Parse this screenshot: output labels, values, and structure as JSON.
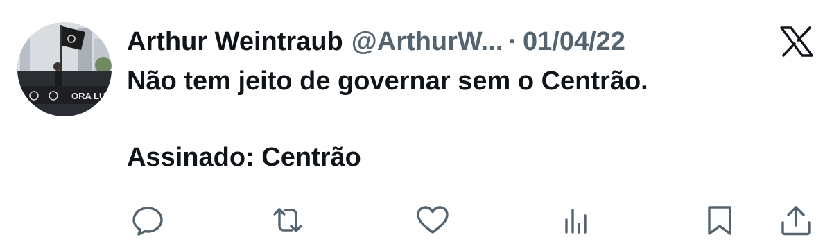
{
  "author": {
    "name": "Arthur Weintraub",
    "handle": "@ArthurW...",
    "separator": "·",
    "date": "01/04/22"
  },
  "tweet": {
    "line1": "Não tem jeito de governar sem o Centrão.",
    "line2": "Assinado: Centrão"
  },
  "avatar": {
    "banner_text": "ORA LUL"
  },
  "actions": {
    "reply_icon": "reply-icon",
    "retweet_icon": "retweet-icon",
    "like_icon": "heart-icon",
    "views_icon": "views-icon",
    "bookmark_icon": "bookmark-icon",
    "share_icon": "share-icon"
  },
  "colors": {
    "text": "#0f1419",
    "secondary": "#536471"
  }
}
